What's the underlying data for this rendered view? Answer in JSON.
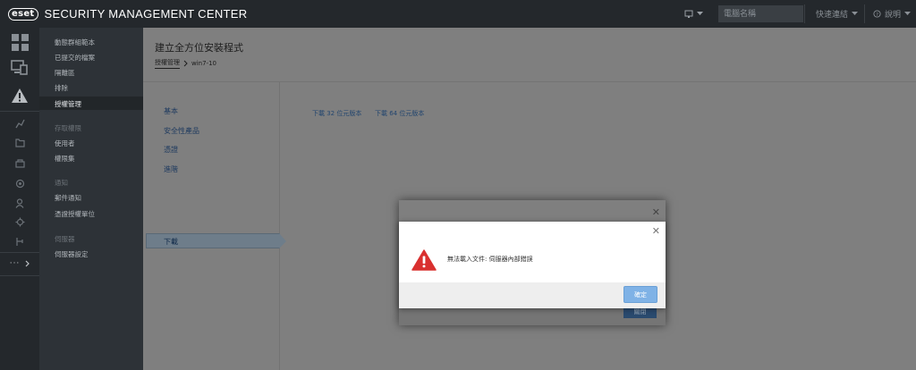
{
  "header": {
    "logo_text": "eset",
    "title": "SECURITY MANAGEMENT CENTER",
    "search_placeholder": "電腦名稱",
    "quick_links": "快速連結",
    "help": "說明"
  },
  "subnav": {
    "items": [
      {
        "label": "動態群組範本",
        "type": "item"
      },
      {
        "label": "已提交的檔案",
        "type": "item"
      },
      {
        "label": "隔離區",
        "type": "item"
      },
      {
        "label": "排除",
        "type": "item"
      },
      {
        "label": "授權管理",
        "type": "active"
      },
      {
        "label": "存取權限",
        "type": "head"
      },
      {
        "label": "使用者",
        "type": "item"
      },
      {
        "label": "權限集",
        "type": "item"
      },
      {
        "label": "通知",
        "type": "head"
      },
      {
        "label": "郵件通知",
        "type": "item"
      },
      {
        "label": "憑證授權單位",
        "type": "item"
      },
      {
        "label": "伺服器",
        "type": "head"
      },
      {
        "label": "伺服器設定",
        "type": "item"
      }
    ]
  },
  "page": {
    "title": "建立全方位安裝程式",
    "breadcrumb": {
      "link": "授權管理",
      "current": "win7-10"
    }
  },
  "steps": [
    "基本",
    "安全性產品",
    "憑證",
    "進階",
    "下載"
  ],
  "downloads": {
    "link_32": "下載 32 位元版本",
    "link_64": "下載 64 位元版本"
  },
  "back_dialog": {
    "button_label": "關閉"
  },
  "dialog": {
    "message": "無法載入文件: 伺服器內部錯誤",
    "ok_label": "確定"
  },
  "colors": {
    "accent": "#7fb2e6",
    "error": "#d9302f",
    "topbar": "#24282c"
  }
}
